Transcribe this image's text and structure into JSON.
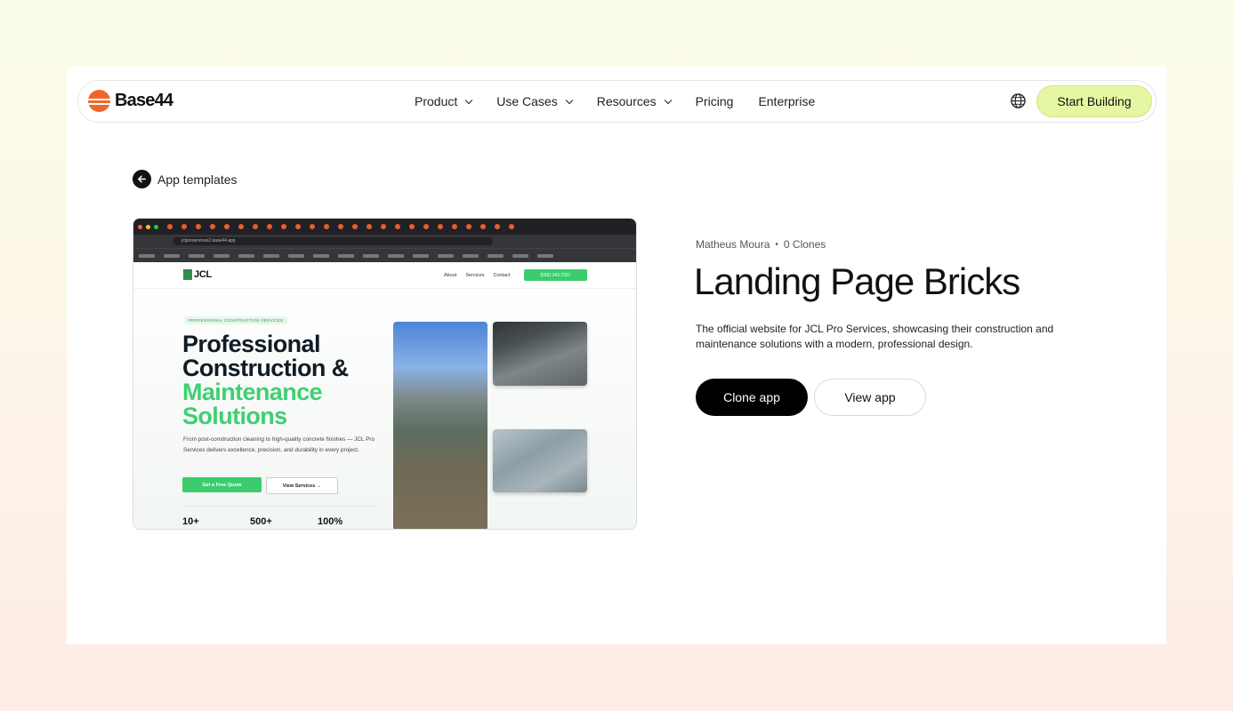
{
  "brand": {
    "name": "Base44",
    "logo_color": "#f0652b"
  },
  "nav": {
    "items": [
      {
        "label": "Product",
        "has_dropdown": true
      },
      {
        "label": "Use Cases",
        "has_dropdown": true
      },
      {
        "label": "Resources",
        "has_dropdown": true
      },
      {
        "label": "Pricing",
        "has_dropdown": false
      },
      {
        "label": "Enterprise",
        "has_dropdown": false
      }
    ],
    "language_icon": "globe-icon",
    "cta_label": "Start Building",
    "cta_color": "#e6f7a3"
  },
  "back_link": {
    "label": "App templates",
    "icon": "arrow-left-icon"
  },
  "template": {
    "author": "Matheus Moura",
    "clones": "0 Clones",
    "title": "Landing Page Bricks",
    "description": "The official website for JCL Pro Services, showcasing their construction and maintenance solutions with a modern, professional design.",
    "clone_label": "Clone app",
    "view_label": "View app"
  },
  "preview": {
    "url": "jclproservices2.base44.app",
    "site_logo": "JCL",
    "site_nav": [
      "About",
      "Services",
      "Contact"
    ],
    "phone_label": "(555) 343-7337",
    "badge": "PROFESSIONAL CONSTRUCTION SERVICES",
    "headline_line1": "Professional",
    "headline_line2": "Construction &",
    "headline_line3": "Maintenance",
    "headline_line4": "Solutions",
    "paragraph": "From post-construction cleaning to high-quality concrete finishes — JCL Pro Services delivers excellence, precision, and durability in every project.",
    "cta_primary": "Get a Free Quote",
    "cta_secondary": "View Services →",
    "stats": [
      "10+",
      "500+",
      "100%"
    ],
    "accent_color": "#3ccc6e"
  }
}
